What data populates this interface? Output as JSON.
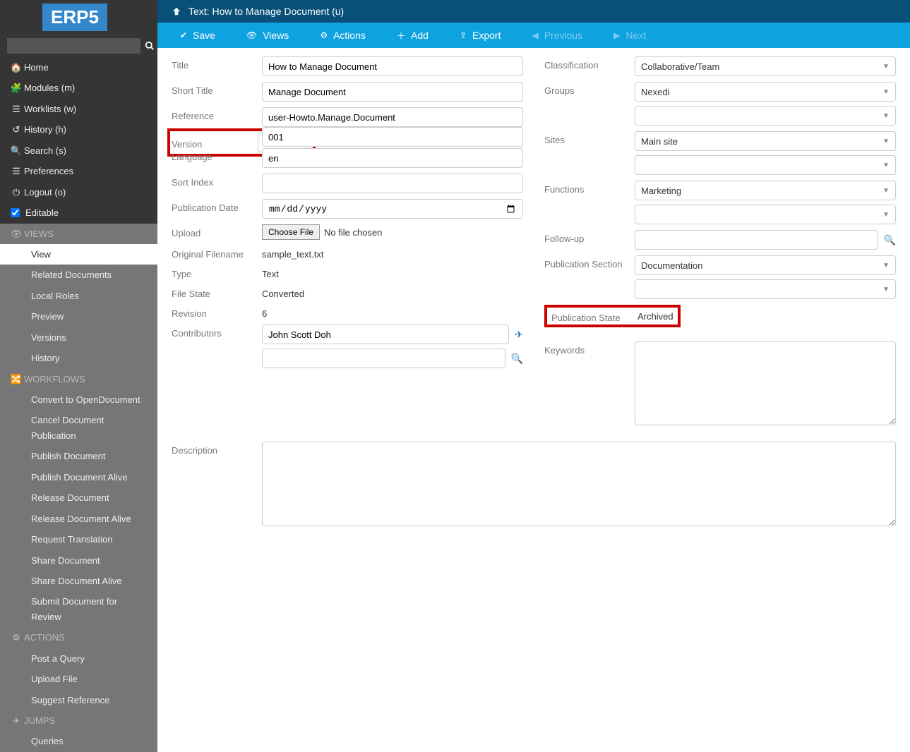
{
  "logo": "ERP5",
  "sidebar": {
    "search_placeholder": "",
    "nav": [
      {
        "icon": "home-icon",
        "label": "Home"
      },
      {
        "icon": "puzzle-icon",
        "label": "Modules (m)"
      },
      {
        "icon": "list-icon",
        "label": "Worklists (w)"
      },
      {
        "icon": "history-icon",
        "label": "History (h)"
      },
      {
        "icon": "search-icon",
        "label": "Search (s)"
      },
      {
        "icon": "sliders-icon",
        "label": "Preferences"
      },
      {
        "icon": "power-icon",
        "label": "Logout (o)"
      }
    ],
    "editable_label": "Editable",
    "editable_checked": true,
    "sections": [
      {
        "icon": "eye-icon",
        "title": "VIEWS",
        "items": [
          "View",
          "Related Documents",
          "Local Roles",
          "Preview",
          "Versions",
          "History"
        ],
        "active": "View"
      },
      {
        "icon": "shuffle-icon",
        "title": "WORKFLOWS",
        "items": [
          "Convert to OpenDocument",
          "Cancel Document Publication",
          "Publish Document",
          "Publish Document Alive",
          "Release Document",
          "Release Document Alive",
          "Request Translation",
          "Share Document",
          "Share Document Alive",
          "Submit Document for Review"
        ]
      },
      {
        "icon": "cogs-icon",
        "title": "ACTIONS",
        "items": [
          "Post a Query",
          "Upload File",
          "Suggest Reference"
        ]
      },
      {
        "icon": "plane-icon",
        "title": "JUMPS",
        "items": [
          "Queries"
        ]
      }
    ]
  },
  "topbar": {
    "title": "Text: How to Manage Document (u)"
  },
  "actionbar": [
    {
      "icon": "check-icon",
      "label": "Save"
    },
    {
      "icon": "eye-icon",
      "label": "Views"
    },
    {
      "icon": "cogs-icon",
      "label": "Actions"
    },
    {
      "icon": "plus-icon",
      "label": "Add"
    },
    {
      "icon": "export-icon",
      "label": "Export"
    },
    {
      "icon": "prev-icon",
      "label": "Previous",
      "disabled": true
    },
    {
      "icon": "next-icon",
      "label": "Next",
      "disabled": true
    }
  ],
  "form": {
    "left": {
      "title": {
        "label": "Title",
        "value": "How to Manage Document"
      },
      "short_title": {
        "label": "Short Title",
        "value": "Manage Document"
      },
      "reference": {
        "label": "Reference",
        "value": "user-Howto.Manage.Document"
      },
      "version": {
        "label": "Version",
        "value": "001"
      },
      "language": {
        "label": "Language",
        "value": "en"
      },
      "sort_index": {
        "label": "Sort Index",
        "value": ""
      },
      "publication_date": {
        "label": "Publication Date",
        "placeholder": "mm/dd/yyyy",
        "value": ""
      },
      "upload": {
        "label": "Upload",
        "button": "Choose File",
        "status": "No file chosen"
      },
      "original_filename": {
        "label": "Original Filename",
        "value": "sample_text.txt"
      },
      "type": {
        "label": "Type",
        "value": "Text"
      },
      "file_state": {
        "label": "File State",
        "value": "Converted"
      },
      "revision": {
        "label": "Revision",
        "value": "6"
      },
      "contributors": {
        "label": "Contributors",
        "values": [
          "John Scott Doh",
          ""
        ]
      }
    },
    "right": {
      "classification": {
        "label": "Classification",
        "value": "Collaborative/Team"
      },
      "groups": {
        "label": "Groups",
        "values": [
          "Nexedi",
          ""
        ]
      },
      "sites": {
        "label": "Sites",
        "values": [
          "Main site",
          ""
        ]
      },
      "functions": {
        "label": "Functions",
        "values": [
          "Marketing",
          ""
        ]
      },
      "follow_up": {
        "label": "Follow-up",
        "value": ""
      },
      "publication_section": {
        "label": "Publication Section",
        "values": [
          "Documentation",
          ""
        ]
      },
      "publication_state": {
        "label": "Publication State",
        "value": "Archived"
      },
      "keywords": {
        "label": "Keywords",
        "value": ""
      }
    },
    "description": {
      "label": "Description",
      "value": ""
    }
  }
}
